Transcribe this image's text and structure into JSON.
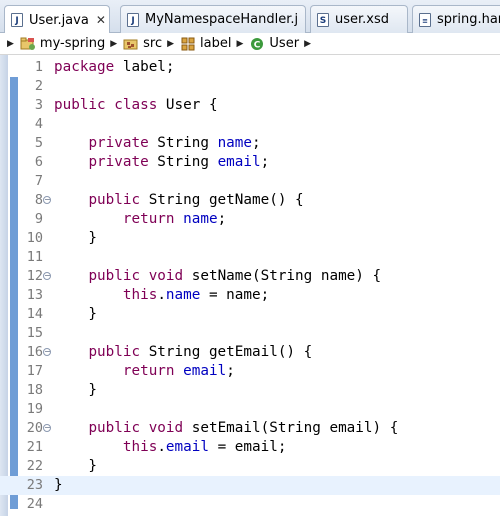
{
  "tabs": [
    {
      "label": "User.java",
      "icon": "java-file-icon",
      "glyph": "J",
      "active": true,
      "close": "✕"
    },
    {
      "label": "MyNamespaceHandler.j",
      "icon": "java-file-icon",
      "glyph": "J",
      "active": false
    },
    {
      "label": "user.xsd",
      "icon": "xsd-file-icon",
      "glyph": "S",
      "active": false
    },
    {
      "label": "spring.hand",
      "icon": "text-file-icon",
      "glyph": "",
      "active": false
    }
  ],
  "breadcrumb": {
    "items": [
      {
        "label": "my-spring",
        "icon": "project-icon"
      },
      {
        "label": "src",
        "icon": "source-folder-icon"
      },
      {
        "label": "label",
        "icon": "package-icon"
      },
      {
        "label": "User",
        "icon": "class-icon"
      }
    ]
  },
  "editor": {
    "current_line": 23,
    "lines": [
      {
        "n": "1",
        "segs": [
          [
            "kw",
            "package"
          ],
          [
            "t",
            " label;"
          ]
        ]
      },
      {
        "n": "2",
        "segs": []
      },
      {
        "n": "3",
        "segs": [
          [
            "kw",
            "public"
          ],
          [
            "t",
            " "
          ],
          [
            "kw",
            "class"
          ],
          [
            "t",
            " User {"
          ]
        ]
      },
      {
        "n": "4",
        "segs": []
      },
      {
        "n": "5",
        "segs": [
          [
            "t",
            "    "
          ],
          [
            "kw",
            "private"
          ],
          [
            "t",
            " String "
          ],
          [
            "fld",
            "name"
          ],
          [
            "t",
            ";"
          ]
        ]
      },
      {
        "n": "6",
        "segs": [
          [
            "t",
            "    "
          ],
          [
            "kw",
            "private"
          ],
          [
            "t",
            " String "
          ],
          [
            "fld",
            "email"
          ],
          [
            "t",
            ";"
          ]
        ]
      },
      {
        "n": "7",
        "segs": []
      },
      {
        "n": "8",
        "fold": true,
        "segs": [
          [
            "t",
            "    "
          ],
          [
            "kw",
            "public"
          ],
          [
            "t",
            " String getName() {"
          ]
        ]
      },
      {
        "n": "9",
        "segs": [
          [
            "t",
            "        "
          ],
          [
            "kw",
            "return"
          ],
          [
            "t",
            " "
          ],
          [
            "fld",
            "name"
          ],
          [
            "t",
            ";"
          ]
        ]
      },
      {
        "n": "10",
        "segs": [
          [
            "t",
            "    }"
          ]
        ]
      },
      {
        "n": "11",
        "segs": []
      },
      {
        "n": "12",
        "fold": true,
        "segs": [
          [
            "t",
            "    "
          ],
          [
            "kw",
            "public"
          ],
          [
            "t",
            " "
          ],
          [
            "kw",
            "void"
          ],
          [
            "t",
            " setName(String name) {"
          ]
        ]
      },
      {
        "n": "13",
        "segs": [
          [
            "t",
            "        "
          ],
          [
            "kw",
            "this"
          ],
          [
            "t",
            "."
          ],
          [
            "fld",
            "name"
          ],
          [
            "t",
            " = name;"
          ]
        ]
      },
      {
        "n": "14",
        "segs": [
          [
            "t",
            "    }"
          ]
        ]
      },
      {
        "n": "15",
        "segs": []
      },
      {
        "n": "16",
        "fold": true,
        "segs": [
          [
            "t",
            "    "
          ],
          [
            "kw",
            "public"
          ],
          [
            "t",
            " String getEmail() {"
          ]
        ]
      },
      {
        "n": "17",
        "segs": [
          [
            "t",
            "        "
          ],
          [
            "kw",
            "return"
          ],
          [
            "t",
            " "
          ],
          [
            "fld",
            "email"
          ],
          [
            "t",
            ";"
          ]
        ]
      },
      {
        "n": "18",
        "segs": [
          [
            "t",
            "    }"
          ]
        ]
      },
      {
        "n": "19",
        "segs": []
      },
      {
        "n": "20",
        "fold": true,
        "segs": [
          [
            "t",
            "    "
          ],
          [
            "kw",
            "public"
          ],
          [
            "t",
            " "
          ],
          [
            "kw",
            "void"
          ],
          [
            "t",
            " setEmail(String email) {"
          ]
        ]
      },
      {
        "n": "21",
        "segs": [
          [
            "t",
            "        "
          ],
          [
            "kw",
            "this"
          ],
          [
            "t",
            "."
          ],
          [
            "fld",
            "email"
          ],
          [
            "t",
            " = email;"
          ]
        ]
      },
      {
        "n": "22",
        "segs": [
          [
            "t",
            "    }"
          ]
        ]
      },
      {
        "n": "23",
        "segs": [
          [
            "t",
            "}"
          ]
        ]
      },
      {
        "n": "24",
        "segs": []
      }
    ]
  },
  "colors": {
    "keyword": "#7f0055",
    "field": "#0000c0",
    "change_bar": "#6f9dd6",
    "current_line": "#e8f2fe"
  }
}
